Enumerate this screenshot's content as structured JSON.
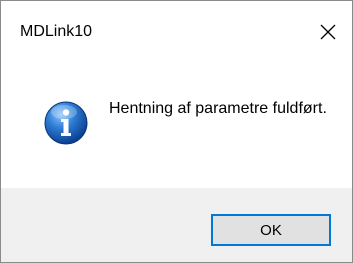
{
  "window": {
    "title": "MDLink10",
    "close_icon": "close-icon"
  },
  "message": {
    "icon": "info-icon",
    "text": "Hentning af parametre fuldført."
  },
  "buttons": {
    "ok_label": "OK"
  },
  "colors": {
    "accent_border": "#0078d7",
    "footer_bg": "#f0f0f0",
    "button_bg": "#e1e1e1",
    "icon_blue": "#1a5fb4"
  }
}
